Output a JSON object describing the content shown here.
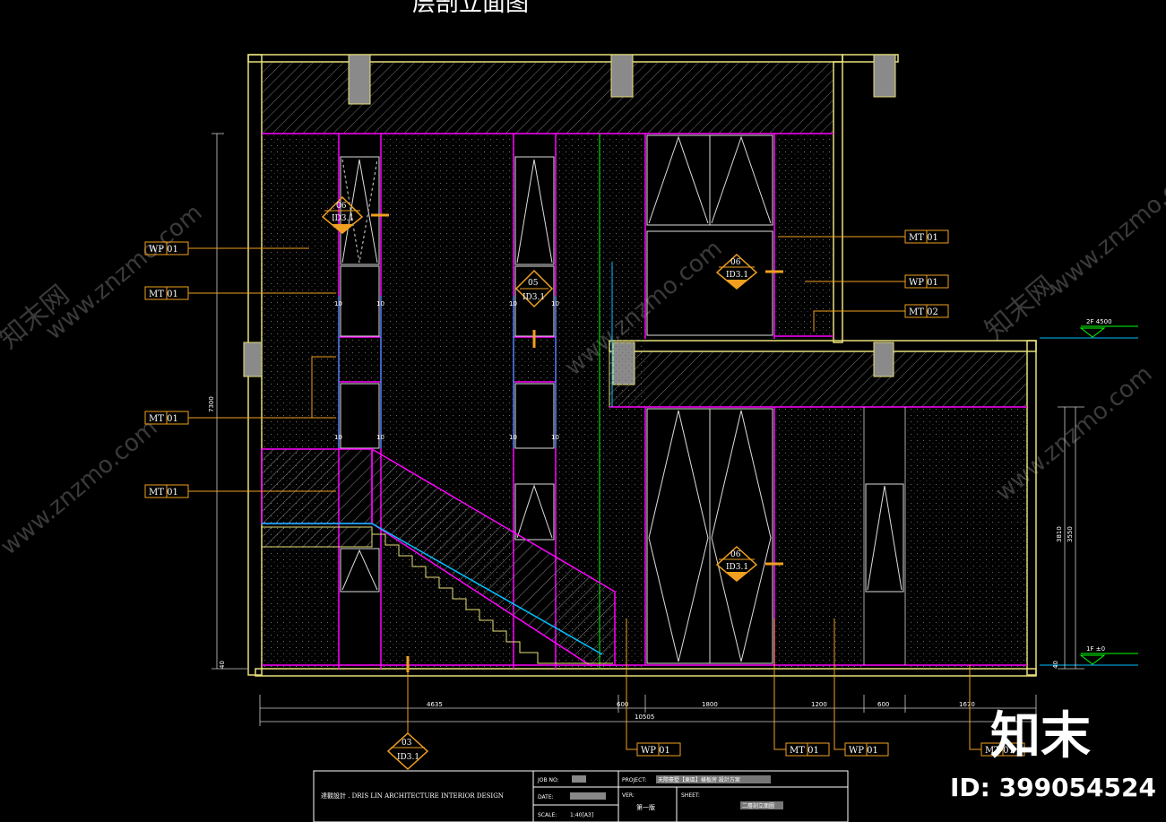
{
  "drawing_title": "层剖立面图",
  "tags": {
    "wp01": "WP 01",
    "mt01": "MT 01",
    "mt02": "MT 02"
  },
  "section_symbols": {
    "num06": "06",
    "num05": "05",
    "num03": "03",
    "ref": "ID3.1"
  },
  "levels": {
    "level_2f": "2F 4500",
    "level_1f": "1F ±0"
  },
  "dimensions": {
    "d4635": "4635",
    "d600": "600",
    "d1800": "1800",
    "d1200": "1200",
    "d1670": "1670",
    "total": "10505",
    "d10": "10",
    "d40": "40",
    "v7300": "7300",
    "v3810": "3810",
    "v3550": "3550"
  },
  "title_block": {
    "company": "達觀設計 . DRIS LIN ARCHITECTURE INTERIOR DESIGN",
    "job_no_label": "JOB NO:",
    "date_label": "DATE:",
    "scale_label": "SCALE:",
    "scale_value": "1:40[A3]",
    "project_label": "PROJECT:",
    "project_value": "天際豪墅【東區】樣板房   設計方案",
    "ver_label": "VER:",
    "ver_value": "第一版",
    "sheet_label": "SHEET:",
    "sheet_value": "二層剖立面圖"
  },
  "watermark": {
    "site": "www.znzmo.com",
    "brand_cn": "知末网",
    "logo": "知末",
    "id_text": "ID: 399054524"
  },
  "colors": {
    "background": "#000000",
    "wall_yellow": "#e8e07a",
    "magenta": "#ff00ff",
    "cyan": "#00c0ff",
    "green": "#00ff00",
    "white": "#ffffff",
    "orange": "#f0a020",
    "gray_block": "#8a8a8a"
  }
}
